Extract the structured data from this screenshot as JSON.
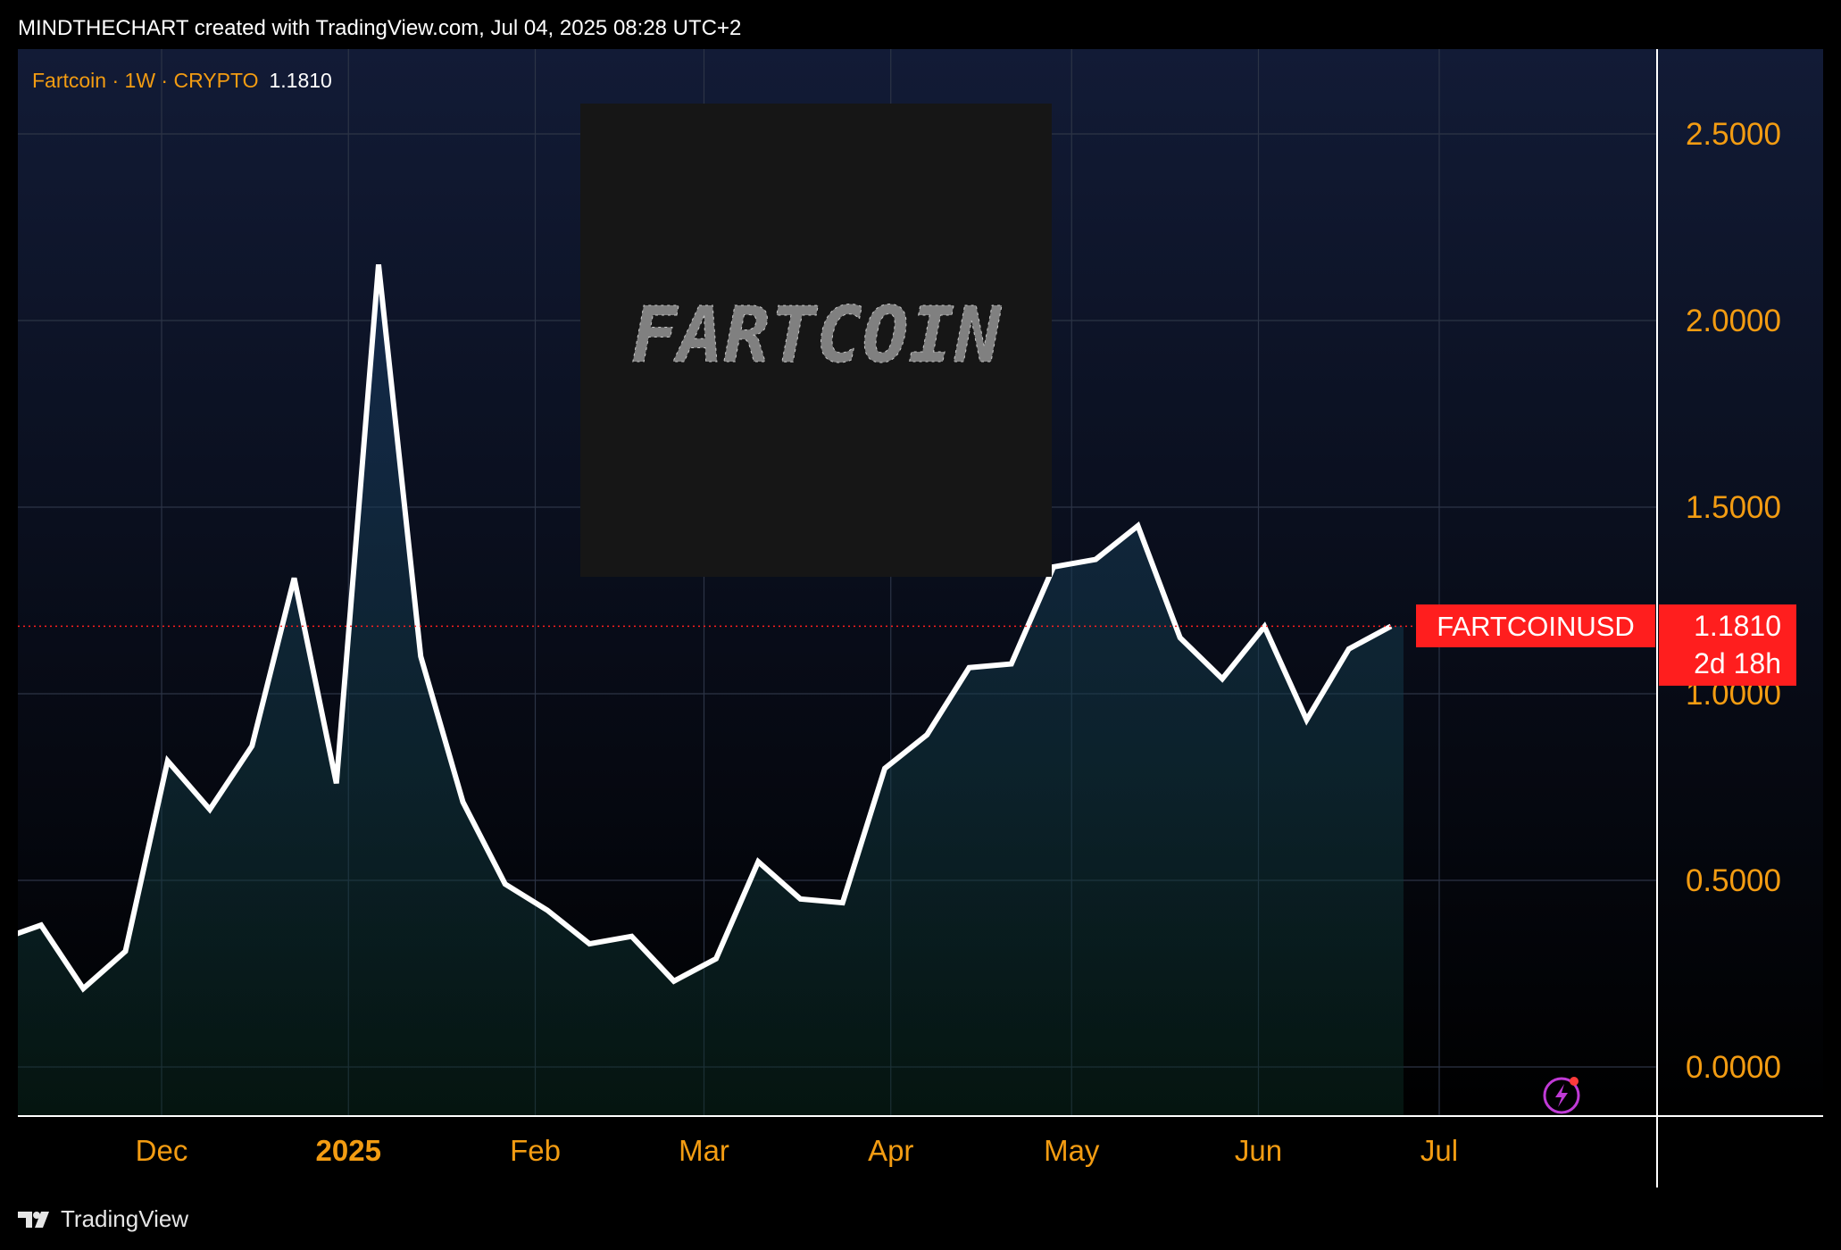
{
  "header": {
    "text": "MINDTHECHART created with TradingView.com, Jul 04, 2025 08:28 UTC+2"
  },
  "legend": {
    "symbol": "Fartcoin · 1W · CRYPTO",
    "last_price": "1.1810"
  },
  "price_tag": {
    "symbol": "FARTCOINUSD",
    "price": "1.1810",
    "countdown": "2d 18h",
    "color": "#ff1e1e"
  },
  "footer": {
    "brand": "TradingView"
  },
  "inset_image": {
    "text": "FARTCOIN"
  },
  "colors": {
    "accent": "#f39c12",
    "line": "#ffffff",
    "bg_top": "#121b36",
    "bg_bottom": "#000000",
    "tag": "#ff1e1e",
    "badge": "#c03ad6"
  },
  "icons": {
    "badge": "lightning-badge-icon",
    "logo": "tradingview-logo-icon"
  },
  "chart_data": {
    "type": "area",
    "title": "",
    "xlabel": "",
    "ylabel": "",
    "ylim": [
      -0.13,
      2.72
    ],
    "yticks": [
      "0.0000",
      "0.5000",
      "1.0000",
      "1.5000",
      "2.0000",
      "2.5000"
    ],
    "ytick_values": [
      0,
      0.5,
      1.0,
      1.5,
      2.0,
      2.5
    ],
    "xticks": [
      {
        "label": "Dec",
        "date": "2024-12-01",
        "bold": false
      },
      {
        "label": "2025",
        "date": "2025-01-01",
        "bold": true
      },
      {
        "label": "Feb",
        "date": "2025-02-01",
        "bold": false
      },
      {
        "label": "Mar",
        "date": "2025-03-01",
        "bold": false
      },
      {
        "label": "Apr",
        "date": "2025-04-01",
        "bold": false
      },
      {
        "label": "May",
        "date": "2025-05-01",
        "bold": false
      },
      {
        "label": "Jun",
        "date": "2025-06-01",
        "bold": false
      },
      {
        "label": "Jul",
        "date": "2025-07-01",
        "bold": false
      }
    ],
    "grid": true,
    "legend_position": "top-left",
    "series": [
      {
        "x": [
          "2024-11-04",
          "2024-11-11",
          "2024-11-18",
          "2024-11-25",
          "2024-12-02",
          "2024-12-09",
          "2024-12-16",
          "2024-12-23",
          "2024-12-30",
          "2025-01-06",
          "2025-01-13",
          "2025-01-20",
          "2025-01-27",
          "2025-02-03",
          "2025-02-10",
          "2025-02-17",
          "2025-02-24",
          "2025-03-03",
          "2025-03-10",
          "2025-03-17",
          "2025-03-24",
          "2025-03-31",
          "2025-04-07",
          "2025-04-14",
          "2025-04-21",
          "2025-04-28",
          "2025-05-05",
          "2025-05-12",
          "2025-05-19",
          "2025-05-26",
          "2025-06-02",
          "2025-06-09",
          "2025-06-16",
          "2025-06-23"
        ],
        "values": [
          0.34,
          0.38,
          0.21,
          0.31,
          0.82,
          0.69,
          0.86,
          1.31,
          0.76,
          2.15,
          1.1,
          0.71,
          0.49,
          0.42,
          0.33,
          0.35,
          0.23,
          0.29,
          0.55,
          0.45,
          0.44,
          0.8,
          0.89,
          1.07,
          1.08,
          1.34,
          1.36,
          1.45,
          1.15,
          1.04,
          1.18,
          0.93,
          1.12,
          1.181
        ]
      }
    ],
    "last_value": 1.181
  }
}
